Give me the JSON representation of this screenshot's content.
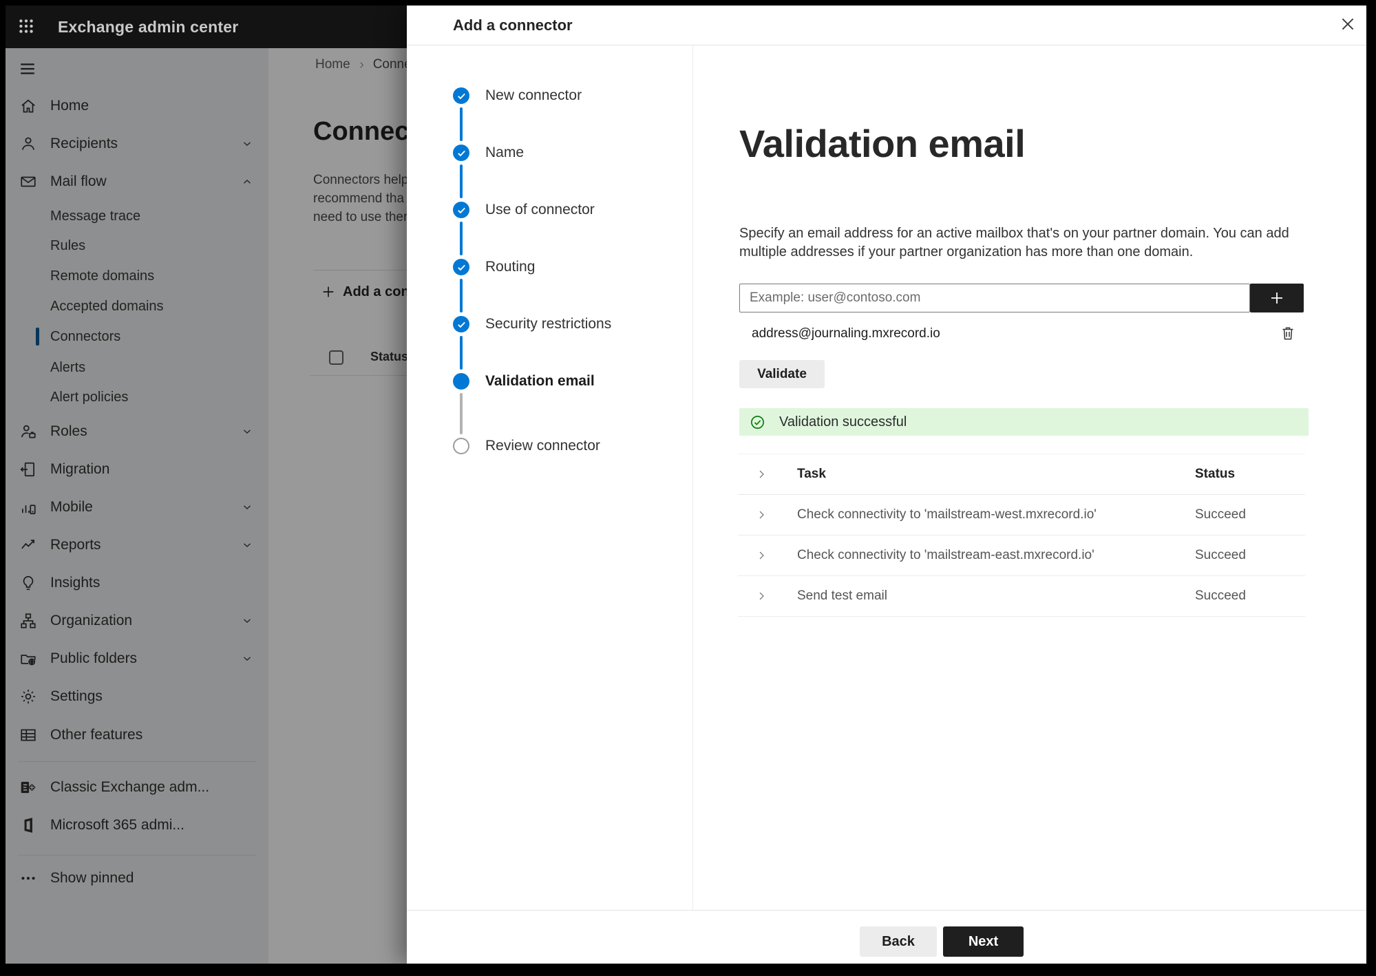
{
  "topbar": {
    "title": "Exchange admin center"
  },
  "sidebar": {
    "items": [
      {
        "label": "Home",
        "icon": "home",
        "kind": "top"
      },
      {
        "label": "Recipients",
        "icon": "person",
        "kind": "top",
        "chevron": "down"
      },
      {
        "label": "Mail flow",
        "icon": "mail",
        "kind": "top",
        "chevron": "up"
      },
      {
        "label": "Message trace",
        "kind": "sub"
      },
      {
        "label": "Rules",
        "kind": "sub"
      },
      {
        "label": "Remote domains",
        "kind": "sub"
      },
      {
        "label": "Accepted domains",
        "kind": "sub"
      },
      {
        "label": "Connectors",
        "kind": "sub",
        "selected": true
      },
      {
        "label": "Alerts",
        "kind": "sub"
      },
      {
        "label": "Alert policies",
        "kind": "sub"
      },
      {
        "label": "Roles",
        "icon": "roles",
        "kind": "top",
        "chevron": "down"
      },
      {
        "label": "Migration",
        "icon": "migration",
        "kind": "top"
      },
      {
        "label": "Mobile",
        "icon": "mobile",
        "kind": "top",
        "chevron": "down"
      },
      {
        "label": "Reports",
        "icon": "reports",
        "kind": "top",
        "chevron": "down"
      },
      {
        "label": "Insights",
        "icon": "insights",
        "kind": "top"
      },
      {
        "label": "Organization",
        "icon": "organization",
        "kind": "top",
        "chevron": "down"
      },
      {
        "label": "Public folders",
        "icon": "public-folders",
        "kind": "top",
        "chevron": "down"
      },
      {
        "label": "Settings",
        "icon": "settings",
        "kind": "top"
      },
      {
        "label": "Other features",
        "icon": "other-features",
        "kind": "top"
      },
      {
        "label": "Classic Exchange adm...",
        "icon": "exchange-logo",
        "kind": "top"
      },
      {
        "label": "Microsoft 365 admi...",
        "icon": "office-logo",
        "kind": "top"
      },
      {
        "label": "Show pinned",
        "icon": "ellipsis",
        "kind": "top"
      }
    ]
  },
  "page": {
    "breadcrumb": {
      "home": "Home",
      "current": "Conne"
    },
    "title": "Connec",
    "paragraph_lines": [
      "Connectors help",
      "recommend tha",
      "need to use ther"
    ],
    "add_button": "Add a conn",
    "list_header": "Status"
  },
  "panel": {
    "title": "Add a connector",
    "steps": [
      {
        "label": "New connector",
        "state": "done"
      },
      {
        "label": "Name",
        "state": "done"
      },
      {
        "label": "Use of connector",
        "state": "done"
      },
      {
        "label": "Routing",
        "state": "done"
      },
      {
        "label": "Security restrictions",
        "state": "done"
      },
      {
        "label": "Validation email",
        "state": "current"
      },
      {
        "label": "Review connector",
        "state": "upcoming"
      }
    ],
    "content": {
      "heading": "Validation email",
      "description_lines": [
        "Specify an email address for an active mailbox that's on your partner domain. You can add",
        "multiple addresses if your partner organization has more than one domain."
      ],
      "email_input_placeholder": "Example: user@contoso.com",
      "added_address": "address@journaling.mxrecord.io",
      "validate_button": "Validate",
      "banner_text": "Validation successful",
      "table": {
        "columns": [
          "Task",
          "Status"
        ],
        "rows": [
          {
            "task": "Check connectivity to 'mailstream-west.mxrecord.io'",
            "status": "Succeed"
          },
          {
            "task": "Check connectivity to 'mailstream-east.mxrecord.io'",
            "status": "Succeed"
          },
          {
            "task": "Send test email",
            "status": "Succeed"
          }
        ]
      }
    },
    "footer": {
      "back": "Back",
      "next": "Next"
    }
  },
  "colors": {
    "accent": "#0078d4",
    "success_bg": "#dff6dd",
    "success_icon": "#107c10",
    "primary_button_bg": "#1f1f1f"
  }
}
